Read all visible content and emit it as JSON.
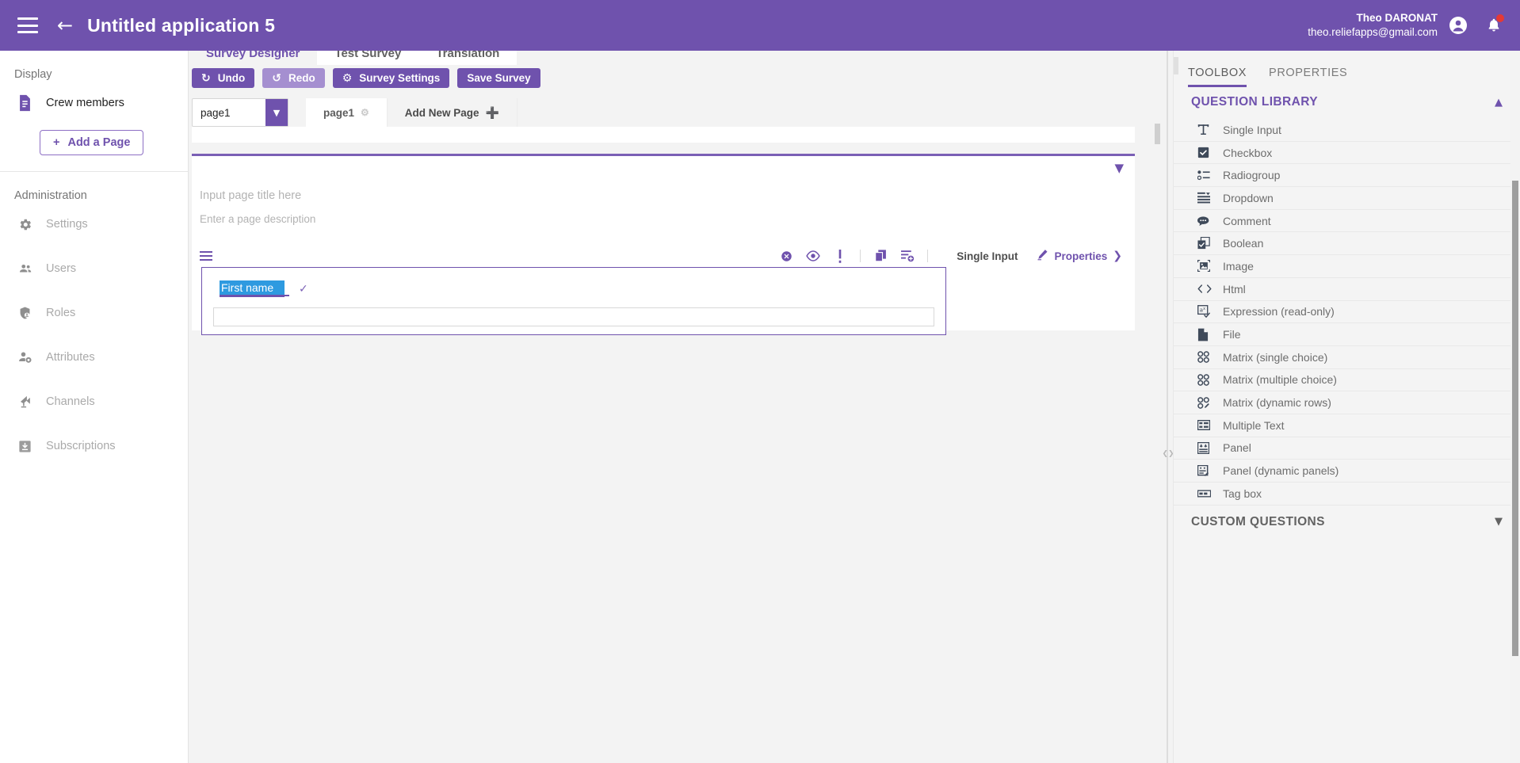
{
  "appbar": {
    "title": "Untitled application 5",
    "menu_icon": "hamburger-icon",
    "back_icon": "arrow-left-icon",
    "user_name": "Theo DARONAT",
    "user_email": "theo.reliefapps@gmail.com",
    "account_icon": "account-circle-icon",
    "notification_icon": "bell-icon",
    "brand_color": "#6f52ad"
  },
  "sidebar": {
    "display_title": "Display",
    "pages": [
      {
        "label": "Crew members",
        "icon": "document-icon"
      }
    ],
    "add_page_label": "Add a Page",
    "administration_title": "Administration",
    "admin_items": [
      {
        "label": "Settings",
        "icon": "gear-icon"
      },
      {
        "label": "Users",
        "icon": "people-icon"
      },
      {
        "label": "Roles",
        "icon": "shield-person-icon"
      },
      {
        "label": "Attributes",
        "icon": "person-gear-icon"
      },
      {
        "label": "Channels",
        "icon": "broadcast-icon"
      },
      {
        "label": "Subscriptions",
        "icon": "download-box-icon"
      }
    ]
  },
  "designer": {
    "tabs": [
      {
        "label": "Survey Designer",
        "active": true
      },
      {
        "label": "Test Survey",
        "active": false
      },
      {
        "label": "Translation",
        "active": false
      }
    ],
    "toolbar": {
      "undo_label": "Undo",
      "undo_icon": "undo-icon",
      "redo_label": "Redo",
      "redo_icon": "redo-icon",
      "settings_label": "Survey Settings",
      "settings_icon": "gear-icon",
      "save_label": "Save Survey"
    },
    "page_select_value": "page1",
    "page_select_icon": "chevron-down-icon",
    "page_tabs": [
      {
        "label": "page1",
        "icon": "gear-icon",
        "active": true
      }
    ],
    "add_page_tab": {
      "label": "Add New Page",
      "icon": "plus-icon"
    },
    "page_card": {
      "collapse_icon": "chevron-down-icon",
      "title_placeholder": "Input page title here",
      "description_placeholder": "Enter a page description"
    },
    "question": {
      "drag_icon": "drag-handle-icon",
      "actions": [
        {
          "name": "delete-question",
          "icon": "close-circle-icon"
        },
        {
          "name": "preview-question",
          "icon": "eye-icon"
        },
        {
          "name": "required-question",
          "icon": "exclamation-icon"
        },
        {
          "name": "duplicate-question",
          "icon": "copy-icon"
        },
        {
          "name": "add-question",
          "icon": "list-add-icon"
        }
      ],
      "type_label": "Single Input",
      "properties_label": "Properties",
      "properties_icon": "pencil-icon",
      "properties_chevron": "chevron-right-icon",
      "title_value": "First name",
      "title_selected": true,
      "confirm_icon": "check-icon",
      "answer_value": ""
    }
  },
  "rightpanel": {
    "tabs": [
      {
        "label": "TOOLBOX",
        "active": true
      },
      {
        "label": "PROPERTIES",
        "active": false
      }
    ],
    "collapse_icon": "chevron-handle-icon",
    "question_library": {
      "title": "QUESTION LIBRARY",
      "chevron": "chevron-up-icon",
      "expanded": true,
      "items": [
        {
          "label": "Single Input",
          "icon": "text-T-icon"
        },
        {
          "label": "Checkbox",
          "icon": "checkbox-icon"
        },
        {
          "label": "Radiogroup",
          "icon": "radio-list-icon"
        },
        {
          "label": "Dropdown",
          "icon": "dropdown-icon"
        },
        {
          "label": "Comment",
          "icon": "comment-icon"
        },
        {
          "label": "Boolean",
          "icon": "boolean-icon"
        },
        {
          "label": "Image",
          "icon": "image-icon"
        },
        {
          "label": "Html",
          "icon": "code-icon"
        },
        {
          "label": "Expression (read-only)",
          "icon": "expression-icon"
        },
        {
          "label": "File",
          "icon": "file-icon"
        },
        {
          "label": "Matrix (single choice)",
          "icon": "matrix-single-icon"
        },
        {
          "label": "Matrix (multiple choice)",
          "icon": "matrix-multiple-icon"
        },
        {
          "label": "Matrix (dynamic rows)",
          "icon": "matrix-dynamic-icon"
        },
        {
          "label": "Multiple Text",
          "icon": "multitext-icon"
        },
        {
          "label": "Panel",
          "icon": "panel-icon"
        },
        {
          "label": "Panel (dynamic panels)",
          "icon": "panel-dynamic-icon"
        },
        {
          "label": "Tag box",
          "icon": "tagbox-icon"
        }
      ]
    },
    "custom_questions": {
      "title": "CUSTOM QUESTIONS",
      "chevron": "chevron-down-icon",
      "expanded": false
    }
  }
}
